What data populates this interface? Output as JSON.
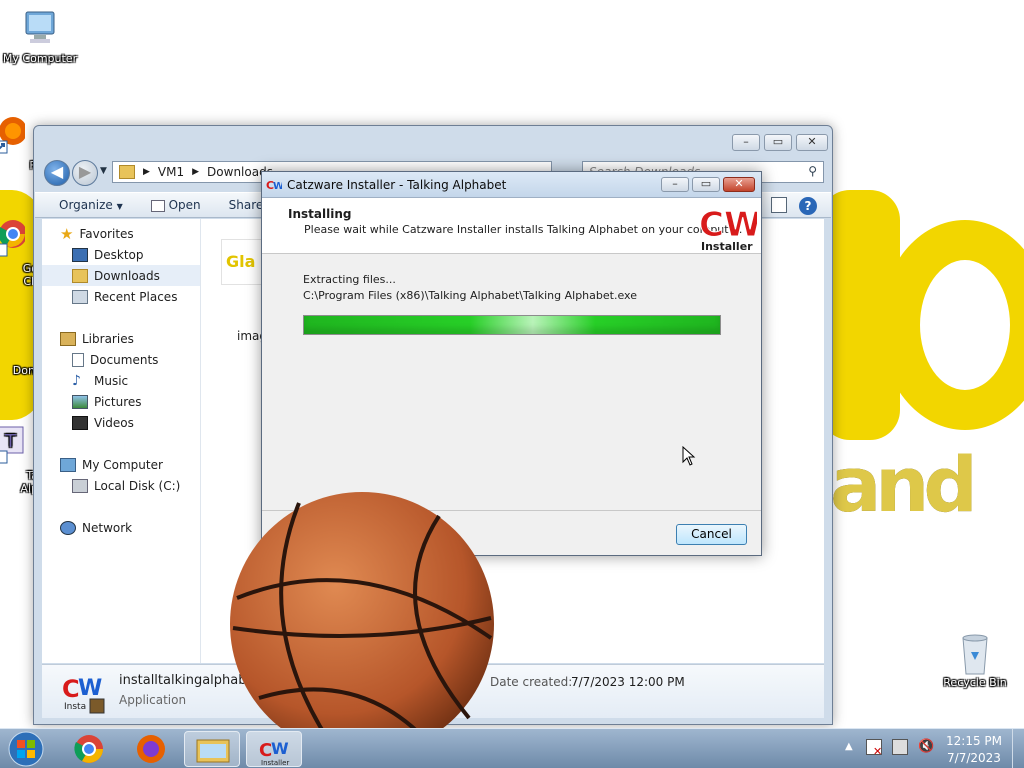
{
  "desktop": {
    "icons": [
      {
        "label": "My Computer"
      },
      {
        "label": "Fi"
      },
      {
        "label": "Go\nCh"
      },
      {
        "label": "Don'"
      },
      {
        "label": "Ta\nAlp"
      },
      {
        "label": "Recycle Bin"
      }
    ]
  },
  "explorer": {
    "breadcrumb": [
      "VM1",
      "Downloads"
    ],
    "search_placeholder": "Search Downloads",
    "toolbar": {
      "organize": "Organize",
      "open": "Open",
      "share": "Share"
    },
    "nav": {
      "favorites": "Favorites",
      "desktop": "Desktop",
      "downloads": "Downloads",
      "recent": "Recent Places",
      "libraries": "Libraries",
      "documents": "Documents",
      "music": "Music",
      "pictures": "Pictures",
      "videos": "Videos",
      "computer": "My Computer",
      "localdisk": "Local Disk (C:)",
      "network": "Network"
    },
    "file_partial_label": "imag",
    "file_partial_thumb": "Gla",
    "details": {
      "filename": "installtalkingalphabet.",
      "type": "Application",
      "date_label": "Date created:",
      "date_value": "7/7/2023 12:00 PM"
    }
  },
  "installer": {
    "title": "Catzware Installer - Talking Alphabet",
    "heading": "Installing",
    "subheading": "Please wait while Catzware Installer installs Talking Alphabet on your computer.",
    "logo_letters": "CW",
    "logo_word": "Installer",
    "status": "Extracting files...",
    "path": "C:\\Program Files (x86)\\Talking Alphabet\\Talking Alphabet.exe",
    "progress": 1.0,
    "cancel": "Cancel"
  },
  "taskbar": {
    "time": "12:15 PM",
    "date": "7/7/2023"
  },
  "colors": {
    "wallpaper_yellow": "#f2d600",
    "progress_green": "#22c322",
    "titlebar_blue": "#c4d6ea",
    "taskbar": "#7f99b6"
  }
}
